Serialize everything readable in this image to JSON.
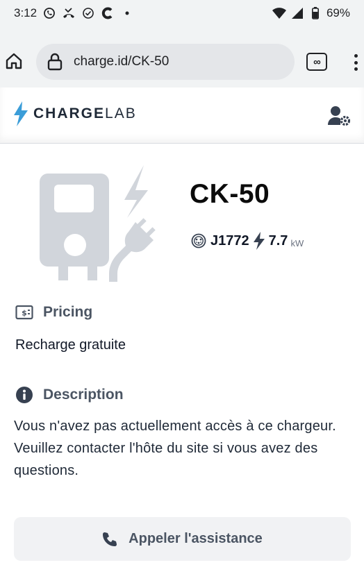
{
  "status_bar": {
    "time": "3:12",
    "battery": "69%",
    "left_icons": [
      "whatsapp-icon",
      "missed-call-icon",
      "check-circle-icon",
      "app-c-icon",
      "dot-icon"
    ],
    "right_icons": [
      "wifi-icon",
      "signal-icon",
      "battery-icon"
    ]
  },
  "browser": {
    "url": "charge.id/CK-50",
    "tabs_label": "∞"
  },
  "header": {
    "logo_bold": "CHARGE",
    "logo_light": "LAB"
  },
  "station": {
    "name": "CK-50",
    "connector": "J1772",
    "power": "7.7",
    "power_unit": "kW"
  },
  "pricing": {
    "title": "Pricing",
    "text": "Recharge gratuite"
  },
  "description": {
    "title": "Description",
    "text": "Vous n'avez pas actuellement accès à ce chargeur. Veuillez contacter l'hôte du site si vous avez des questions."
  },
  "support": {
    "label": "Appeler l'assistance"
  },
  "colors": {
    "accent": "#3b9dd8",
    "illustration": "#d1d5db",
    "button_bg": "#f1f2f4"
  }
}
